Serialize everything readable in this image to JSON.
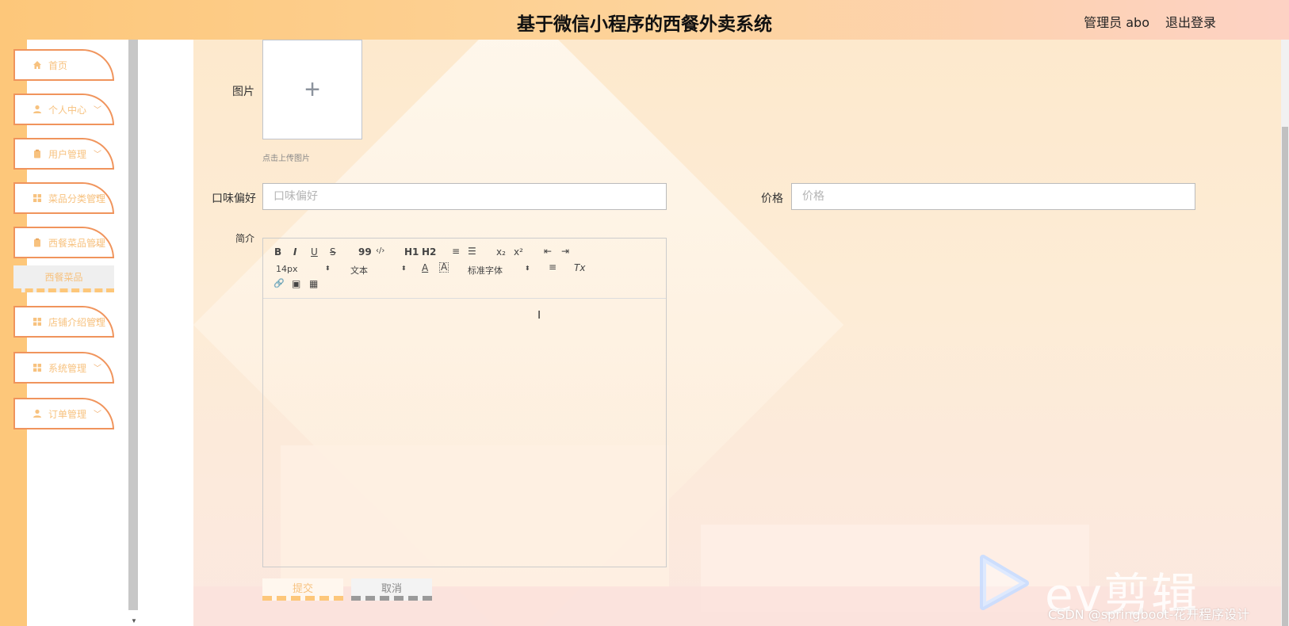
{
  "header": {
    "title": "基于微信小程序的西餐外卖系统",
    "user": "管理员 abo",
    "logout": "退出登录"
  },
  "sidebar": {
    "items": [
      {
        "label": "首页",
        "icon": "home-icon"
      },
      {
        "label": "个人中心",
        "icon": "user-icon"
      },
      {
        "label": "用户管理",
        "icon": "clipboard-icon"
      },
      {
        "label": "菜品分类管理",
        "icon": "grid-icon"
      },
      {
        "label": "西餐菜品管理",
        "icon": "clipboard-icon"
      },
      {
        "label": "店铺介绍管理",
        "icon": "grid-icon"
      },
      {
        "label": "系统管理",
        "icon": "grid-icon"
      },
      {
        "label": "订单管理",
        "icon": "user-icon"
      }
    ],
    "submenu": "西餐菜品"
  },
  "form": {
    "image_label": "图片",
    "upload_plus": "+",
    "upload_tip": "点击上传图片",
    "taste_label": "口味偏好",
    "taste_placeholder": "口味偏好",
    "price_label": "价格",
    "price_placeholder": "价格",
    "intro_label": "简介",
    "submit": "提交",
    "cancel": "取消"
  },
  "editor": {
    "buttons": {
      "bold": "B",
      "italic": "I",
      "underline": "U",
      "strike": "S",
      "quote": "99",
      "code": "‹/›",
      "h1": "H1",
      "h2": "H2",
      "ordered_list": "≡",
      "bullet_list": "☰",
      "subscript": "x₂",
      "superscript": "x²",
      "outdent": "⇤",
      "indent": "⇥",
      "font_color": "A",
      "bg_color": "A",
      "align": "≡",
      "clean": "Tx",
      "link": "🔗",
      "image": "▣",
      "video": "▦"
    },
    "size_select": "14px",
    "header_select": "文本",
    "font_select": "标准字体"
  },
  "watermark": {
    "brand": "ev剪辑",
    "csdn": "CSDN @springboot-花开程序设计"
  },
  "colors": {
    "accent": "#fdc77a",
    "menu_border": "#f0945c",
    "menu_text": "#f7c27f"
  }
}
